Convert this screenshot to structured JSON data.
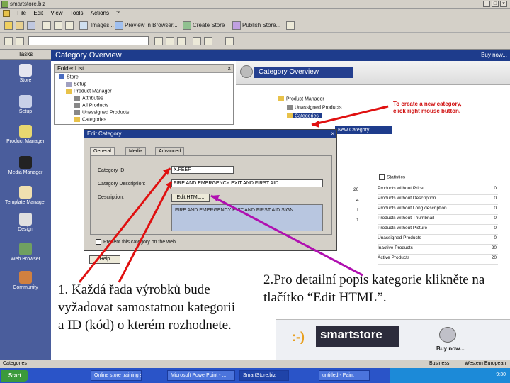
{
  "window": {
    "title": "smartstore.biz"
  },
  "menu": [
    "File",
    "Edit",
    "View",
    "Tools",
    "Actions",
    "?"
  ],
  "toolbar": {
    "items": [
      "Images...",
      "Preview in Browser...",
      "Create Store",
      "Publish Store..."
    ]
  },
  "sidebar": {
    "header": "Tasks",
    "items": [
      "Store",
      "Setup",
      "Product Manager",
      "Media Manager",
      "Template Manager",
      "Design",
      "Web Browser",
      "Community"
    ]
  },
  "panel": {
    "title": "Category Overview",
    "right": "Buy now..."
  },
  "folder_list": {
    "title": "Folder List",
    "items": [
      "Store",
      "Setup",
      "Product Manager",
      "Attributes",
      "All Products",
      "Unassigned Products",
      "Categories"
    ]
  },
  "right_pane": {
    "header": "Category Overview",
    "tree": [
      "Product Manager",
      "Unassigned Products",
      "Categories"
    ],
    "context_menu": "New Category...",
    "hint": "To create a new category, click right mouse button.",
    "stats_header": "Statistics",
    "stats": [
      {
        "label": "Products without Price",
        "value": "0"
      },
      {
        "label": "Products without Description",
        "value": "0"
      },
      {
        "label": "Products without Long description",
        "value": "0"
      },
      {
        "label": "Products without Thumbnail",
        "value": "0"
      },
      {
        "label": "Products without Picture",
        "value": "0"
      },
      {
        "label": "Unassigned Products",
        "value": "0"
      },
      {
        "label": "Inactive Products",
        "value": "20"
      },
      {
        "label": "Active Products",
        "value": "20"
      }
    ],
    "left_counts": [
      "20",
      "4",
      "1",
      "1"
    ]
  },
  "dialog": {
    "title": "Edit Category",
    "tabs": [
      "General",
      "Media",
      "Advanced"
    ],
    "fields": {
      "category_id_label": "Category ID:",
      "category_id_value": "X.FEEF",
      "description_label": "Category Description:",
      "description_value": "FIRE AND EMERGENCY EXIT AND FIRST AID",
      "long_label": "Description:",
      "edit_html": "Edit HTML...",
      "long_value": "FIRE AND EMERGENCY EXIT AND FIRST AID SIGN"
    },
    "checkbox": "Present this category on the web",
    "help_button": "Help"
  },
  "notes": {
    "note1": "1.  Každá řada výrobků bude vyžadovat samostatnou kategorii a ID (kód) o kterém rozhodnete.",
    "note2": "2.Pro detailní popis kategorie klikněte na tlačítko “Edit HTML”."
  },
  "banner": {
    "logo": "smartstore",
    "buy": "Buy now..."
  },
  "footer": {
    "business": "Business",
    "western": "Western European"
  },
  "statusbar": {
    "text": "Categories"
  },
  "taskbar": {
    "start": "Start",
    "tasks": [
      "Online store training sec",
      "Microsoft PowerPoint - ...",
      "SmartStore.biz",
      "untitled - Paint"
    ],
    "time": "9:30"
  },
  "colors": {
    "accent": "#1e3c8c",
    "sidebar": "#4a5d9c",
    "arrow_red": "#e01010",
    "arrow_purple": "#b010b0"
  }
}
